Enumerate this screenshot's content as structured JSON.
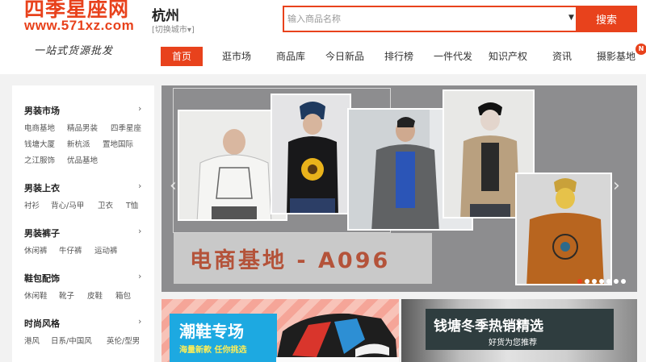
{
  "header": {
    "logo_text": "四季星座网",
    "logo_url": "www.571xz.com",
    "slogan": "一站式货源批发",
    "city": "杭州",
    "city_switch": "[切换城市▾]"
  },
  "search": {
    "placeholder": "输入商品名称",
    "dropdown_icon": "▼",
    "button_label": "搜索"
  },
  "nav": {
    "items": [
      "首页",
      "逛市场",
      "商品库",
      "今日新品",
      "排行榜",
      "一件代发",
      "知识产权",
      "资讯",
      "摄影基地"
    ],
    "badge": "N"
  },
  "sidebar": {
    "categories": [
      {
        "title": "男装市场",
        "links": [
          "电商基地",
          "精品男装",
          "四季星座",
          "钱塘大厦",
          "新杭派",
          "置地国际",
          "之江服饰",
          "优品基地"
        ]
      },
      {
        "title": "男装上衣",
        "links": [
          "衬衫",
          "背心/马甲",
          "卫衣",
          "T恤"
        ]
      },
      {
        "title": "男装裤子",
        "links": [
          "休闲裤",
          "牛仔裤",
          "运动裤"
        ]
      },
      {
        "title": "鞋包配饰",
        "links": [
          "休闲鞋",
          "靴子",
          "皮鞋",
          "箱包"
        ]
      },
      {
        "title": "时尚风格",
        "links": [
          "港风",
          "日系/中国风",
          "英伦/型男"
        ]
      }
    ],
    "arrow_icon": "›"
  },
  "banner": {
    "title": "电商基地 - A096",
    "prev_icon": "‹",
    "next_icon": "›",
    "slide_count": 7,
    "active_slide": 1
  },
  "promos": {
    "left_title": "潮鞋专场",
    "left_subtitle": "海量新款 任你挑选",
    "right_title": "钱塘冬季热销精选",
    "right_subtitle": "好货为您推荐"
  },
  "colors": {
    "accent": "#e8421c",
    "banner_bg": "#8d8d8f",
    "promo_blue": "#1da9e1"
  }
}
